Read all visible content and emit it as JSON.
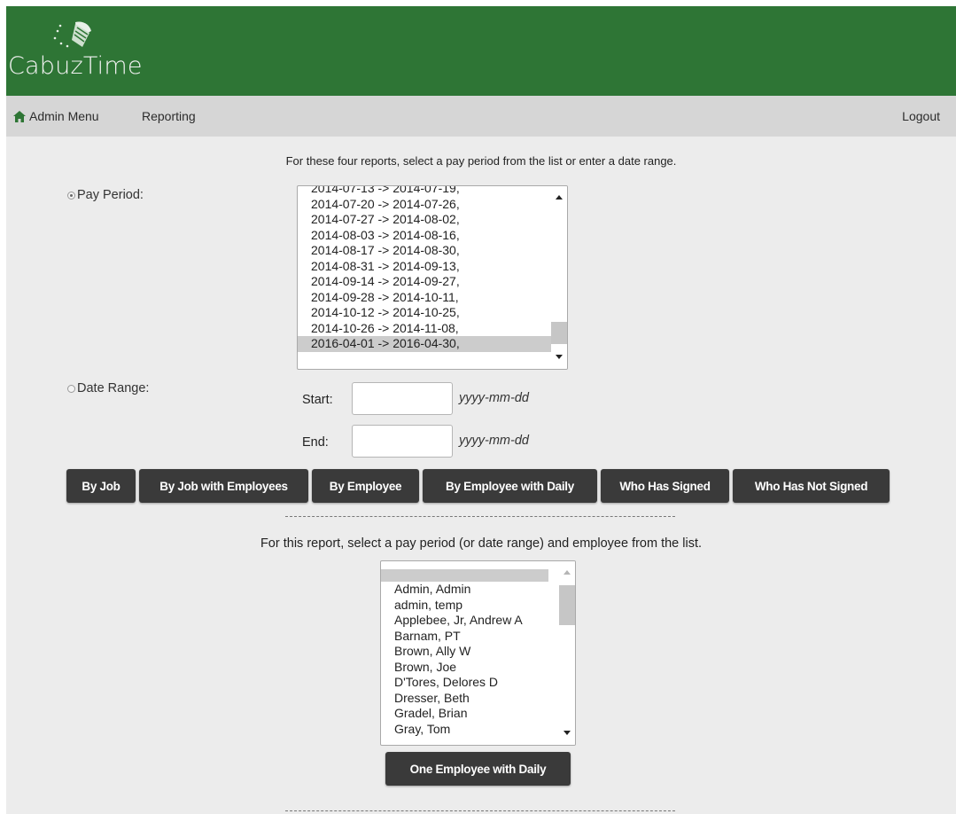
{
  "app": {
    "name": "CabuzTime"
  },
  "nav": {
    "admin_menu": "Admin Menu",
    "reporting": "Reporting",
    "logout": "Logout"
  },
  "section1": {
    "intro": "For these four reports, select a pay period from the list or enter a date range.",
    "pay_period_label": "Pay Period:",
    "pay_periods": [
      "2014-07-13 -> 2014-07-19,",
      "2014-07-20 -> 2014-07-26,",
      "2014-07-27 -> 2014-08-02,",
      "2014-08-03 -> 2014-08-16,",
      "2014-08-17 -> 2014-08-30,",
      "2014-08-31 -> 2014-09-13,",
      "2014-09-14 -> 2014-09-27,",
      "2014-09-28 -> 2014-10-11,",
      "2014-10-12 -> 2014-10-25,",
      "2014-10-26 -> 2014-11-08,",
      "2016-04-01 -> 2016-04-30,"
    ],
    "selected_pay_period": "2016-04-01 -> 2016-04-30,",
    "date_range_label": "Date Range:",
    "start_label": "Start:",
    "end_label": "End:",
    "start_value": "",
    "end_value": "",
    "date_hint": "yyyy-mm-dd",
    "buttons": [
      "By Job",
      "By Job with Employees",
      "By Employee",
      "By Employee with Daily",
      "Who Has Signed",
      "Who Has Not Signed"
    ]
  },
  "section2": {
    "intro": "For this report, select a pay period (or date range) and employee from the list.",
    "employees": [
      "",
      "Admin, Admin",
      "admin, temp",
      "Applebee, Jr, Andrew A",
      "Barnam, PT",
      "Brown, Ally W",
      "Brown, Joe",
      "D'Tores, Delores D",
      "Dresser, Beth",
      "Gradel, Brian",
      "Gray, Tom"
    ],
    "button": "One Employee with Daily"
  },
  "colors": {
    "header": "#2e7535",
    "navbar": "#d6d6d6",
    "button": "#3a3a3a",
    "background": "#ececec"
  }
}
